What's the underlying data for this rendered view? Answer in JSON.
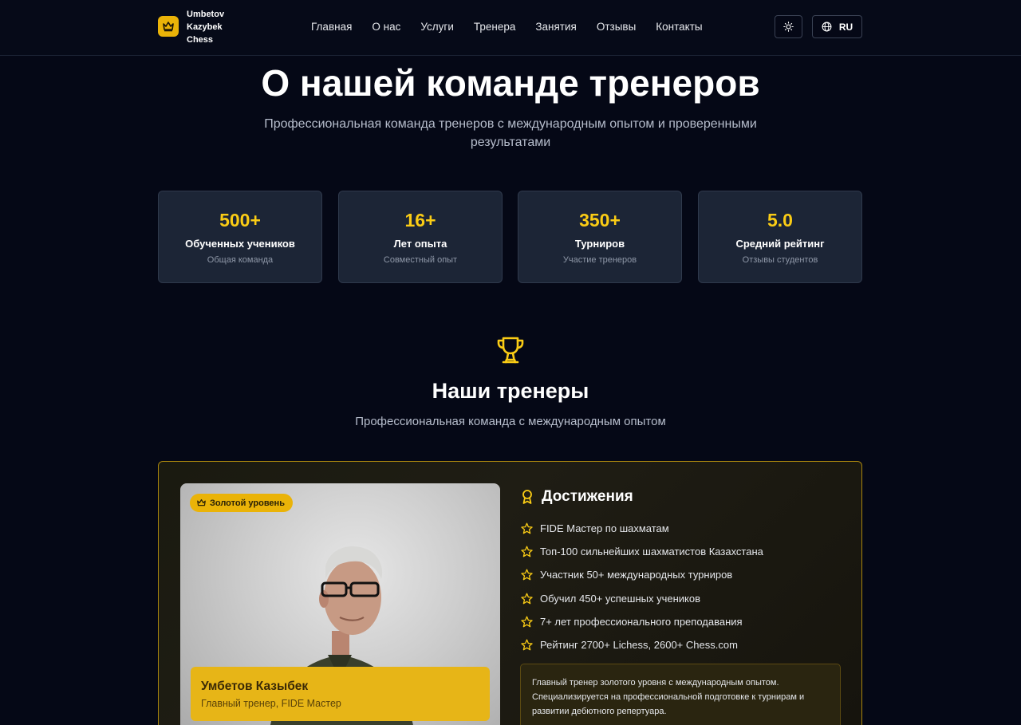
{
  "brand": {
    "name": "Umbetov Kazybek Chess"
  },
  "nav": [
    "Главная",
    "О нас",
    "Услуги",
    "Тренера",
    "Занятия",
    "Отзывы",
    "Контакты"
  ],
  "header": {
    "lang": "RU"
  },
  "hero": {
    "title": "О нашей команде тренеров",
    "subtitle": "Профессиональная команда тренеров с международным опытом и проверенными результатами"
  },
  "stats": [
    {
      "value": "500+",
      "label": "Обученных учеников",
      "desc": "Общая команда"
    },
    {
      "value": "16+",
      "label": "Лет опыта",
      "desc": "Совместный опыт"
    },
    {
      "value": "350+",
      "label": "Турниров",
      "desc": "Участие тренеров"
    },
    {
      "value": "5.0",
      "label": "Средний рейтинг",
      "desc": "Отзывы студентов"
    }
  ],
  "section": {
    "title": "Наши тренеры",
    "subtitle": "Профессиональная команда с международным опытом"
  },
  "coach": {
    "badge": "Золотой уровень",
    "name": "Умбетов Казыбек",
    "role": "Главный тренер, FIDE Мастер",
    "achievements_title": "Достижения",
    "achievements": [
      "FIDE Мастер по шахматам",
      "Топ-100 сильнейших шахматистов Казахстана",
      "Участник 50+ международных турниров",
      "Обучил 450+ успешных учеников",
      "7+ лет профессионального преподавания",
      "Рейтинг 2700+ Lichess, 2600+ Chess.com"
    ],
    "description": "Главный тренер золотого уровня с международным опытом. Специализируется на профессиональной подготовке к турнирам и развитии дебютного репертуара."
  },
  "colors": {
    "accent": "#facc15",
    "background": "#050816",
    "card": "#1c2536"
  },
  "icons": [
    "crown-icon",
    "sun-icon",
    "globe-icon",
    "trophy-icon",
    "award-icon",
    "star-icon"
  ]
}
